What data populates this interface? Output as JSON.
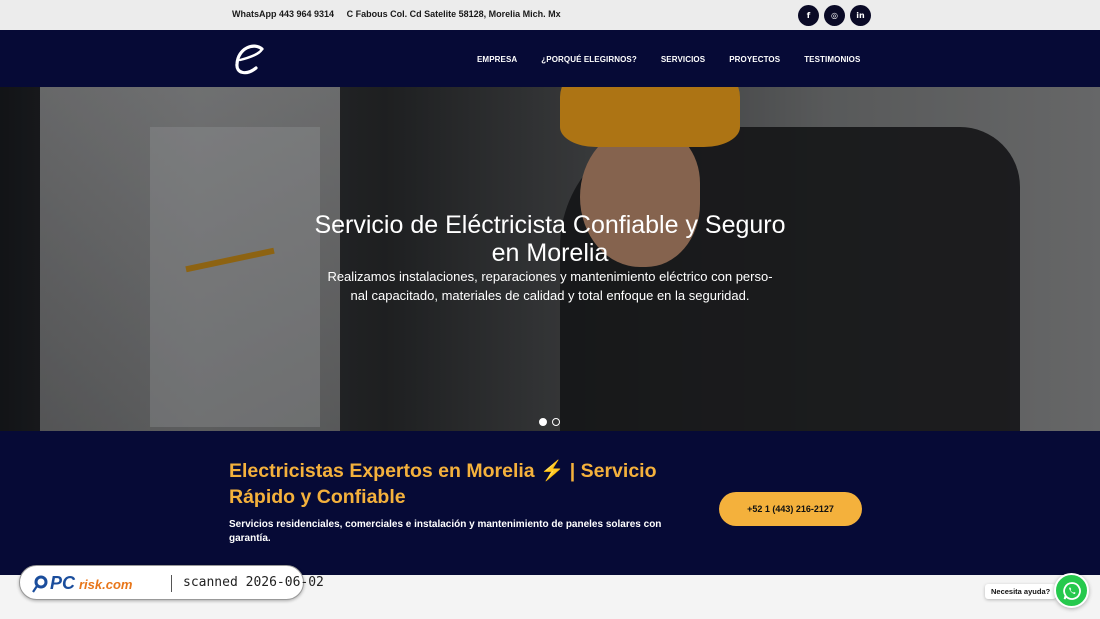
{
  "topbar": {
    "whatsapp": "WhatsApp 443 964 9314",
    "address": "C Fabous Col. Cd Satelite 58128, Morelia Mich. Mx",
    "socials": [
      {
        "label": "f",
        "icon": "facebook-icon"
      },
      {
        "label": "◎",
        "icon": "instagram-icon"
      },
      {
        "label": "in",
        "icon": "linkedin-icon"
      }
    ]
  },
  "header": {
    "logo_letter": "e",
    "nav": [
      "EMPRESA",
      "¿PORQUÉ ELEGIRNOS?",
      "SERVICIOS",
      "PROYECTOS",
      "TESTIMONIOS"
    ]
  },
  "hero": {
    "title": "Servicio de Eléctricista Confiable y Seguro en Morelia",
    "subtitle": "Realizamos instalaciones, reparaciones y mantenimiento eléctrico con perso-nal capacitado, materiales de calidad y total enfoque en la seguridad.",
    "slides": 2,
    "active_slide": 1
  },
  "band": {
    "heading": "Electricistas Expertos en Morelia ⚡ | Servicio Rápido y Confiable",
    "description": "Servicios residenciales, comerciales e instalación y mantenimiento de paneles solares con garantía.",
    "phone_button": "+52 1 (443) 216-2127"
  },
  "watermark": {
    "brand": "PCrisk.com",
    "scan_text": "scanned 2026-06-02"
  },
  "chat": {
    "help_label": "Necesita ayuda?"
  },
  "colors": {
    "navy": "#060a36",
    "accent": "#f4b13c",
    "whatsapp": "#26c94d"
  }
}
